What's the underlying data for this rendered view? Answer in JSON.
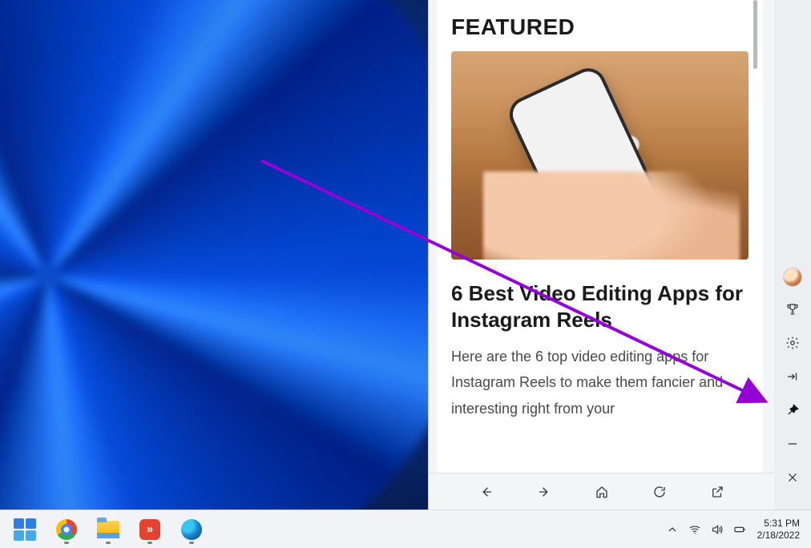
{
  "widgets": {
    "card": {
      "heading": "FEATURED",
      "title": "6 Best Video Editing Apps for Instagram Reels",
      "body": "Here are the 6 top video editing apps for Instagram Reels to make them fancier and interesting right from your"
    },
    "nav": {
      "back": "Back",
      "forward": "Forward",
      "home": "Home",
      "refresh": "Refresh",
      "open": "Open in browser"
    },
    "rail": {
      "profile": "Profile",
      "rewards": "Rewards",
      "settings": "Settings",
      "collapse": "Collapse",
      "pin": "Pin",
      "minimize": "Minimize",
      "close": "Close"
    }
  },
  "taskbar": {
    "start": "Start",
    "chrome": "Google Chrome",
    "explorer": "File Explorer",
    "todoist": "Todoist",
    "todoist_glyph": "»",
    "edge": "Microsoft Edge",
    "tray": {
      "overflow": "Show hidden icons",
      "wifi": "Wi-Fi",
      "volume": "Volume",
      "battery": "Battery"
    },
    "time": "5:31 PM",
    "date": "2/18/2022"
  }
}
